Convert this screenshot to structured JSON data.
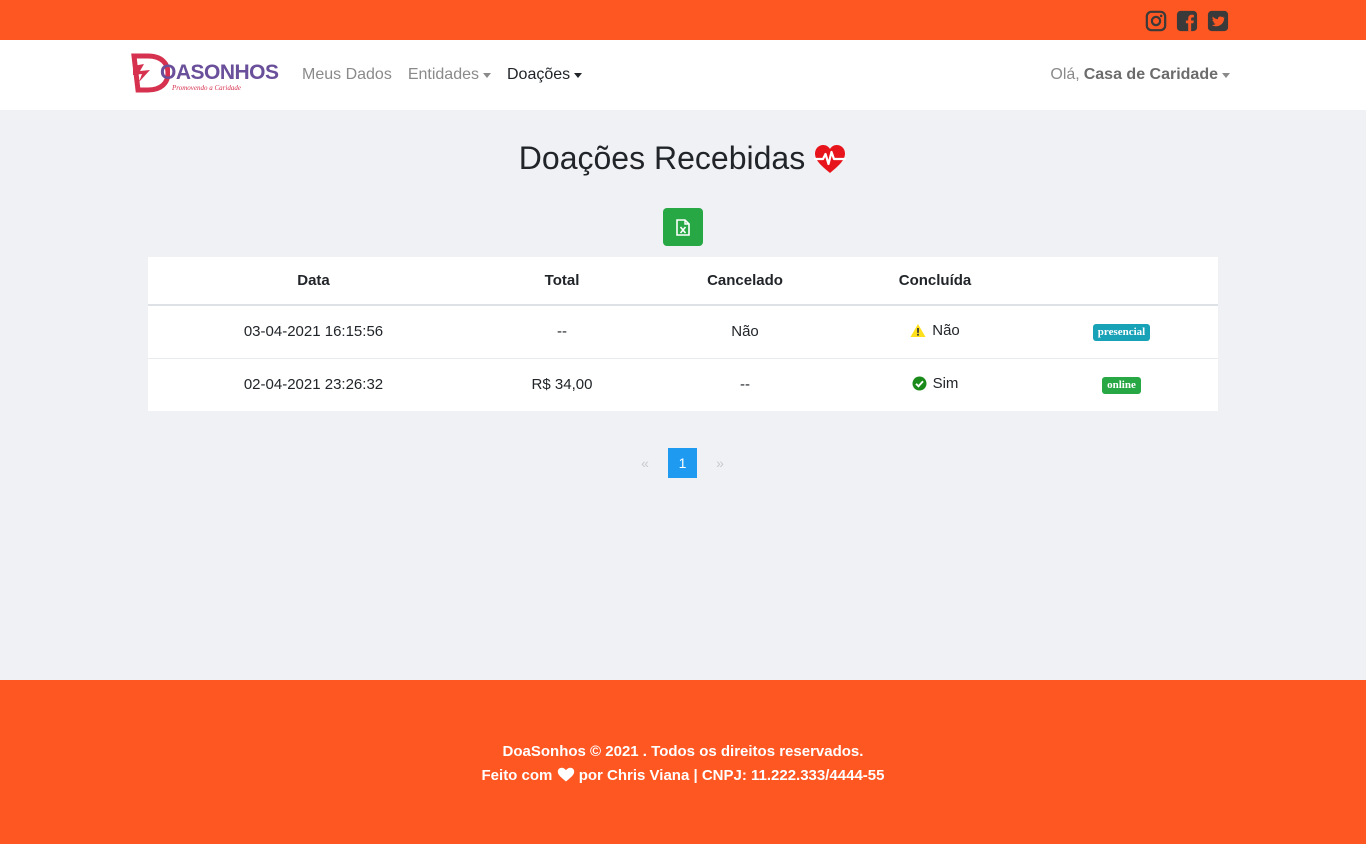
{
  "social": {
    "icons": [
      "instagram-icon",
      "facebook-icon",
      "twitter-icon"
    ],
    "color": "#3a3a3a"
  },
  "brand": {
    "name": "OASONHOS",
    "tagline": "Promovendo a Caridade",
    "colors": {
      "primary": "#6a4f9a",
      "accent": "#d6314f"
    }
  },
  "nav": {
    "items": [
      {
        "label": "Meus Dados",
        "dropdown": false,
        "active": false
      },
      {
        "label": "Entidades",
        "dropdown": true,
        "active": false
      },
      {
        "label": "Doações",
        "dropdown": true,
        "active": true
      }
    ],
    "greeting": "Olá,",
    "user_name": "Casa de Caridade"
  },
  "page": {
    "title": "Doações Recebidas",
    "title_icon": "heartbeat-icon",
    "export_icon": "file-excel-icon"
  },
  "table": {
    "headers": [
      "Data",
      "Total",
      "Cancelado",
      "Concluída",
      ""
    ],
    "rows": [
      {
        "data": "03-04-2021 16:15:56",
        "total": "--",
        "cancelado": "Não",
        "concluida": "Não",
        "concluida_icon": "warning-icon",
        "badge": "presencial",
        "badge_color": "#17a2b8"
      },
      {
        "data": "02-04-2021 23:26:32",
        "total": "R$ 34,00",
        "cancelado": "--",
        "concluida": "Sim",
        "concluida_icon": "check-circle-icon",
        "badge": "online",
        "badge_color": "#28a745"
      }
    ]
  },
  "pagination": {
    "prev": "«",
    "current": "1",
    "next": "»"
  },
  "footer": {
    "line1": "DoaSonhos © 2021 . Todos os direitos reservados.",
    "line2_prefix": "Feito com",
    "line2_suffix": "por Chris Viana | CNPJ: 11.222.333/4444-55"
  },
  "colors": {
    "orange": "#ff5722",
    "success": "#28a745",
    "info": "#17a2b8",
    "page_active": "#1e9bf0",
    "background": "#f0f1f4"
  }
}
